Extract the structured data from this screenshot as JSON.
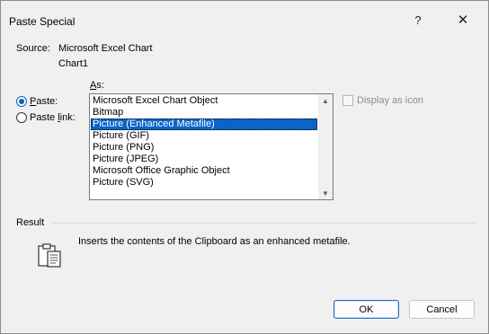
{
  "window": {
    "title": "Paste Special",
    "help_glyph": "?",
    "close_glyph": "✕"
  },
  "source": {
    "label": "Source:",
    "line1": "Microsoft Excel Chart",
    "line2": "Chart1"
  },
  "as_label": "As:",
  "options": {
    "paste_label": "Paste:",
    "paste_link_label": "Paste link:",
    "selected": "paste"
  },
  "list": {
    "items": [
      "Microsoft Excel Chart Object",
      "Bitmap",
      "Picture (Enhanced Metafile)",
      "Picture (GIF)",
      "Picture (PNG)",
      "Picture (JPEG)",
      "Microsoft Office Graphic Object",
      "Picture (SVG)"
    ],
    "selected_index": 2
  },
  "display_as_icon": {
    "label": "Display as icon",
    "checked": false,
    "enabled": false
  },
  "result": {
    "label": "Result",
    "text": "Inserts the contents of the Clipboard as an enhanced metafile.",
    "icon": "clipboard-icon"
  },
  "buttons": {
    "ok": "OK",
    "cancel": "Cancel"
  },
  "colors": {
    "selection": "#0a64c8",
    "radio_accent": "#0a5fb8",
    "default_button_border": "#1a6fc4"
  }
}
